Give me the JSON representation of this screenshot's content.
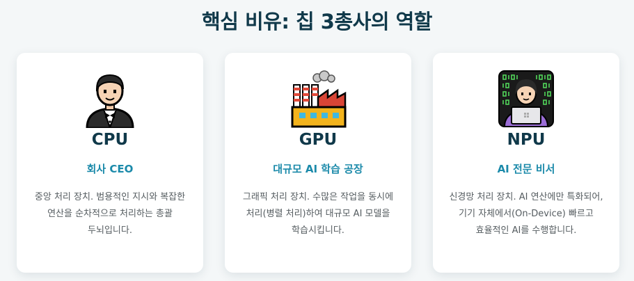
{
  "page": {
    "title": "핵심 비유: 칩 3총사의 역할"
  },
  "cards": [
    {
      "icon": "ceo-person-icon",
      "name": "CPU",
      "role": "회사 CEO",
      "description": "중앙 처리 장치. 범용적인 지시와 복잡한 연산을 순차적으로 처리하는 총괄 두뇌입니다."
    },
    {
      "icon": "factory-icon",
      "name": "GPU",
      "role": "대규모 AI 학습 공장",
      "description": "그래픽 처리 장치. 수많은 작업을 동시에 처리(병렬 처리)하여 대규모 AI 모델을 학습시킵니다."
    },
    {
      "icon": "technologist-icon",
      "name": "NPU",
      "role": "AI 전문 비서",
      "description": "신경망 처리 장치. AI 연산에만 특화되어, 기기 자체에서(On-Device) 빠르고 효율적인 AI를 수행합니다."
    }
  ],
  "colors": {
    "title": "#10394a",
    "role": "#1b8aaa",
    "text": "#555c60",
    "background": "#f4f7f8"
  }
}
